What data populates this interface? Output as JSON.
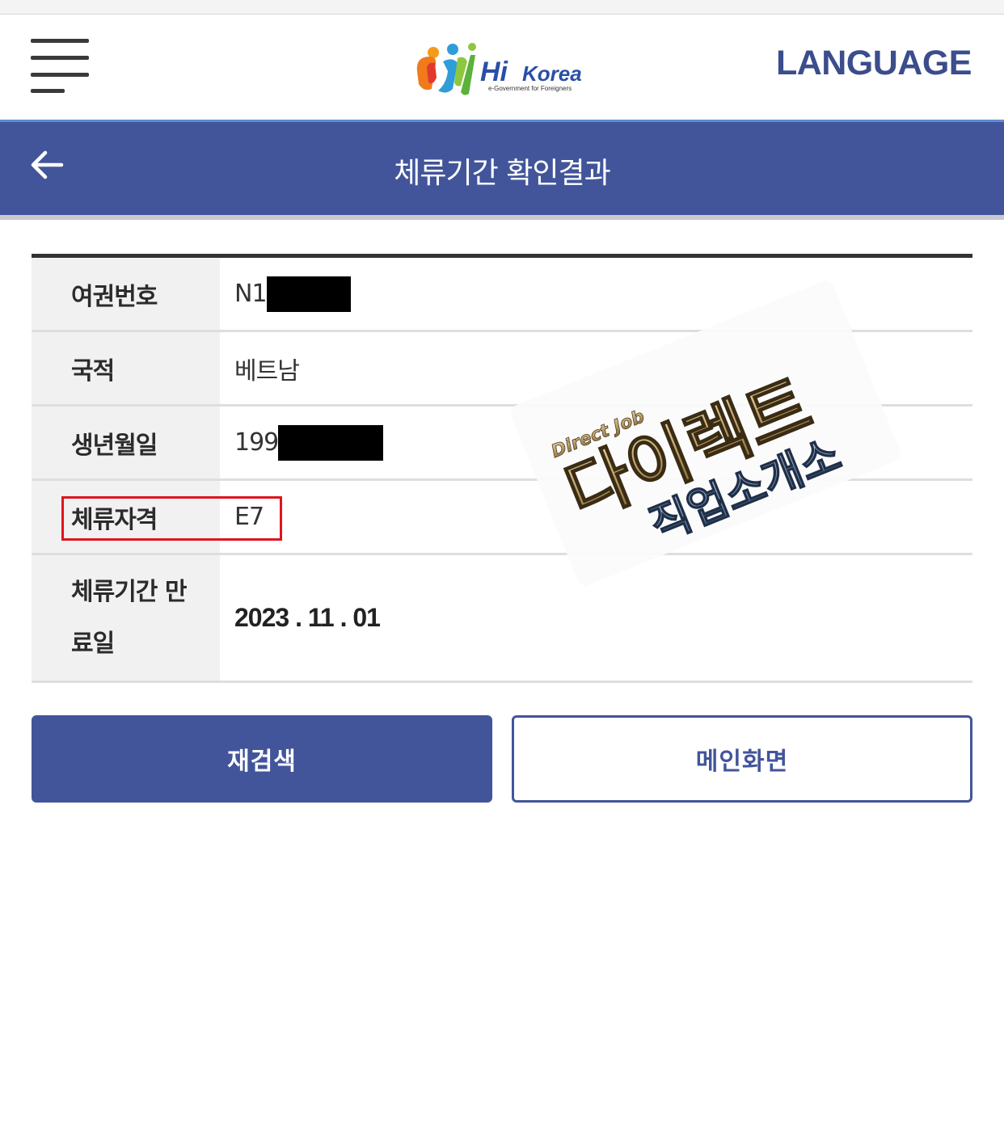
{
  "header": {
    "menu_icon": "hamburger-menu-icon",
    "logo_text": "Hi Korea",
    "logo_subtext": "e-Government for Foreigners",
    "language_label": "LANGUAGE"
  },
  "title_bar": {
    "back_icon": "arrow-left-icon",
    "title": "체류기간 확인결과"
  },
  "info": {
    "rows": [
      {
        "label": "여권번호",
        "value": "N1",
        "redacted": true
      },
      {
        "label": "국적",
        "value": "베트남"
      },
      {
        "label": "생년월일",
        "value": "199",
        "redacted": true
      },
      {
        "label": "체류자격",
        "value": "E7",
        "highlighted": true
      },
      {
        "label": "체류기간 만료일",
        "value": "2023 . 11 . 01"
      }
    ]
  },
  "watermark": {
    "small_text": "Direct Job",
    "main_text": "다이렉트",
    "sub_text": "직업소개소"
  },
  "buttons": {
    "research_label": "재검색",
    "main_label": "메인화면"
  },
  "colors": {
    "primary": "#42559a",
    "highlight_border": "#e0141e",
    "language_text": "#3b4d8c"
  }
}
